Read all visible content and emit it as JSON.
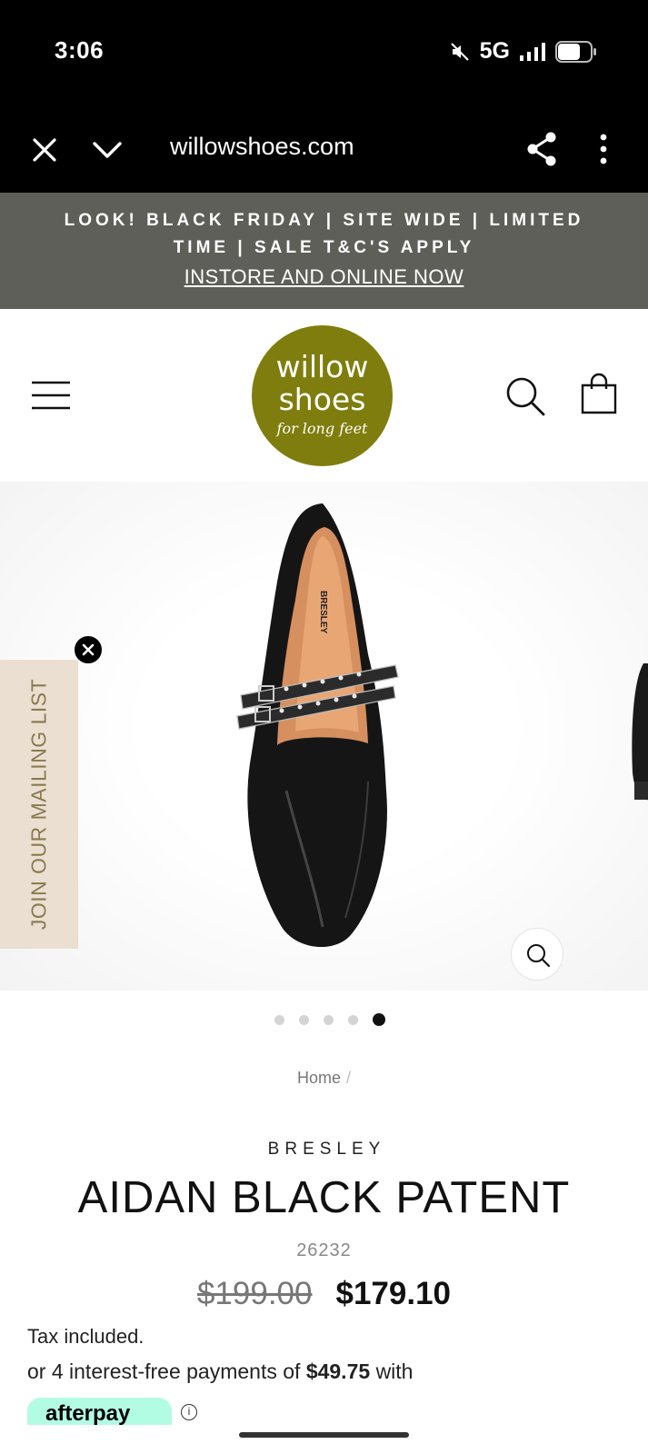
{
  "status_bar": {
    "time": "3:06",
    "network": "5G",
    "icons": [
      "mute-icon",
      "signal-icon",
      "battery-icon"
    ]
  },
  "browser": {
    "url": "willowshoes.com",
    "icons": [
      "close-icon",
      "chevron-down-icon",
      "share-icon",
      "more-vert-icon"
    ]
  },
  "announcement": {
    "text": "LOOK! BLACK FRIDAY | SITE WIDE | LIMITED TIME | SALE T&C'S APPLY",
    "link": "INSTORE AND ONLINE NOW"
  },
  "header": {
    "logo": {
      "line1": "willow",
      "line2": "shoes",
      "tagline": "for long feet",
      "color": "#7f7d0d"
    },
    "icons": [
      "menu-icon",
      "search-icon",
      "cart-icon"
    ]
  },
  "gallery": {
    "slide_count": 5,
    "active_slide": 5,
    "zoom_icon": "zoom-icon"
  },
  "mailing_list": {
    "label": "JOIN OUR MAILING LIST",
    "background": "#ebdfd1"
  },
  "product": {
    "breadcrumb_home": "Home",
    "breadcrumb_separator": "/",
    "vendor": "BRESLEY",
    "title": "AIDAN BLACK PATENT",
    "sku": "26232",
    "price_original": "$199.00",
    "price_sale": "$179.10",
    "tax_note": "Tax included.",
    "installments_prefix": "or 4 interest-free payments of",
    "installments_amount": "$49.75",
    "installments_suffix": "with",
    "afterpay_label": "afterpay",
    "afterpay_color": "#b2fce4"
  }
}
